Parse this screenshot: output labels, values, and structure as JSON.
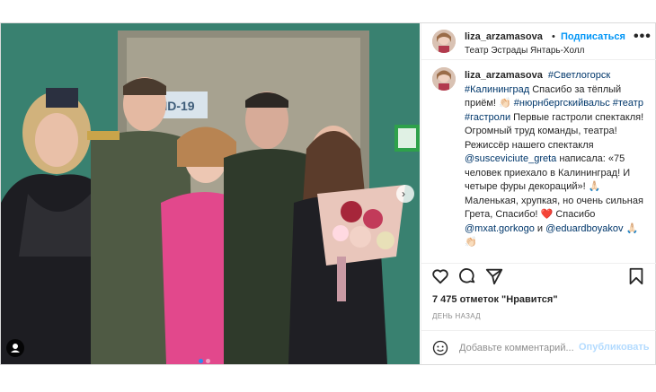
{
  "post": {
    "username": "liza_arzamasova",
    "separator": "•",
    "follow_label": "Подписаться",
    "location": "Театр Эстрады Янтарь-Холл",
    "more_label": "•••",
    "photo_sign_text": "VID-19",
    "caption": {
      "username": "liza_arzamasova",
      "tag_1": "#Светлогорск",
      "tag_2": "#Калининград",
      "text_1": " Спасибо за тёплый приём!",
      "clap_1": "👏🏻",
      "tag_3": "#нюрнбергскийвальс",
      "tag_4": "#театр",
      "tag_5": "#гастроли",
      "text_2": " Первые гастроли спектакля! Огромный труд команды, театра! Режиссёр нашего спектакля ",
      "mention_1": "@susceviciute_greta",
      "text_3": " написала: «75 человек приехало в Калининград! И четыре фуры декораций»!",
      "pray_1": "🙏🏻",
      "text_4": "Маленькая, хрупкая, но очень сильная Грета, Спасибо!",
      "heart": "❤️",
      "text_5": "Спасибо ",
      "mention_2": "@mxat.gorkogo",
      "text_6": " и",
      "mention_3": "@eduardboyakov",
      "pray_2": "🙏🏻",
      "clap_2": "👏🏻"
    },
    "likes": "7 475 отметок \"Нравится\"",
    "time_ago": "ДЕНЬ НАЗАД",
    "comment_placeholder": "Добавьте комментарий...",
    "publish_label": "Опубликовать",
    "nav_next": "›",
    "icons": [
      "heart-icon",
      "comment-icon",
      "share-icon",
      "bookmark-icon",
      "emoji-icon"
    ],
    "colors": {
      "link": "#00376b",
      "follow": "#0095f6",
      "publish_disabled": "#b3dbff",
      "photo_bg": "#3f8a78"
    }
  }
}
